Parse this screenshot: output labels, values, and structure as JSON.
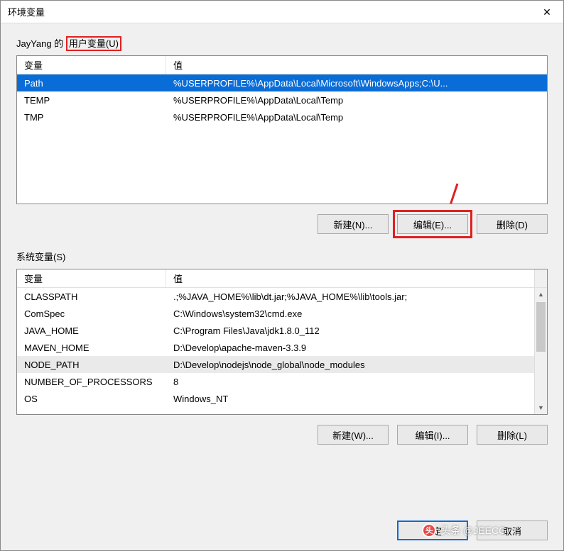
{
  "window": {
    "title": "环境变量",
    "close_glyph": "✕"
  },
  "user_section": {
    "prefix": "JayYang 的 ",
    "highlighted": "用户变量(U)",
    "columns": {
      "variable": "变量",
      "value": "值"
    },
    "rows": [
      {
        "name": "Path",
        "value": "%USERPROFILE%\\AppData\\Local\\Microsoft\\WindowsApps;C:\\U...",
        "selected": true
      },
      {
        "name": "TEMP",
        "value": "%USERPROFILE%\\AppData\\Local\\Temp"
      },
      {
        "name": "TMP",
        "value": "%USERPROFILE%\\AppData\\Local\\Temp"
      }
    ],
    "buttons": {
      "new": "新建(N)...",
      "edit": "编辑(E)...",
      "delete": "删除(D)"
    }
  },
  "system_section": {
    "label": "系统变量(S)",
    "columns": {
      "variable": "变量",
      "value": "值"
    },
    "rows": [
      {
        "name": "CLASSPATH",
        "value": ".;%JAVA_HOME%\\lib\\dt.jar;%JAVA_HOME%\\lib\\tools.jar;"
      },
      {
        "name": "ComSpec",
        "value": "C:\\Windows\\system32\\cmd.exe"
      },
      {
        "name": "JAVA_HOME",
        "value": "C:\\Program Files\\Java\\jdk1.8.0_112"
      },
      {
        "name": "MAVEN_HOME",
        "value": "D:\\Develop\\apache-maven-3.3.9"
      },
      {
        "name": "NODE_PATH",
        "value": "D:\\Develop\\nodejs\\node_global\\node_modules",
        "focus": true
      },
      {
        "name": "NUMBER_OF_PROCESSORS",
        "value": "8"
      },
      {
        "name": "OS",
        "value": "Windows_NT"
      }
    ],
    "buttons": {
      "new": "新建(W)...",
      "edit": "编辑(I)...",
      "delete": "删除(L)"
    }
  },
  "dialog": {
    "ok": "确定",
    "cancel": "取消"
  },
  "watermark": {
    "text": "头条 @JEECG",
    "icon_glyph": "头"
  }
}
